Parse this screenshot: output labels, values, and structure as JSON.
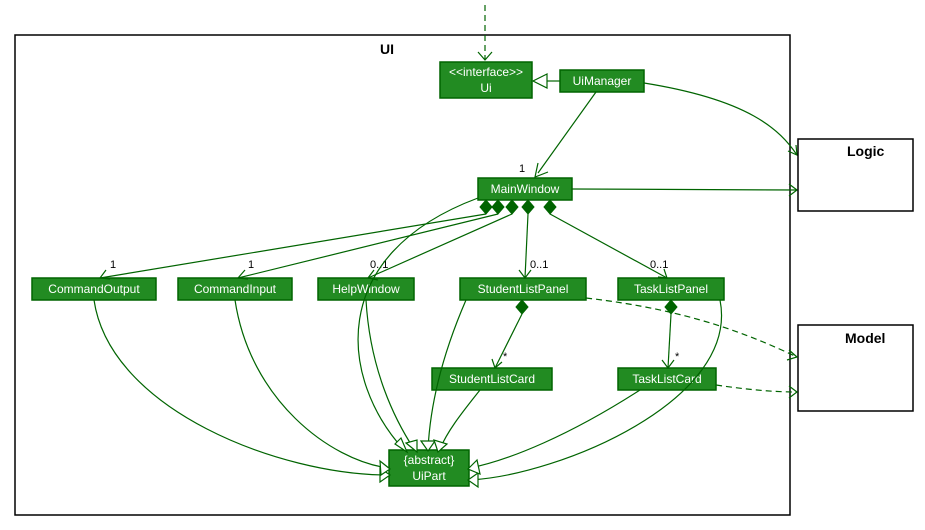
{
  "package": {
    "name": "UI"
  },
  "classes": {
    "ui": {
      "stereotype": "<<interface>>",
      "name": "Ui"
    },
    "uimanager": {
      "name": "UiManager"
    },
    "mainwindow": {
      "name": "MainWindow"
    },
    "cmdout": {
      "name": "CommandOutput"
    },
    "cmdin": {
      "name": "CommandInput"
    },
    "helpwin": {
      "name": "HelpWindow"
    },
    "slpanel": {
      "name": "StudentListPanel"
    },
    "tlpanel": {
      "name": "TaskListPanel"
    },
    "slc": {
      "name": "StudentListCard"
    },
    "tlc": {
      "name": "TaskListCard"
    },
    "uipart": {
      "stereotype": "{abstract}",
      "name": "UiPart"
    }
  },
  "external": {
    "logic": {
      "name": "Logic"
    },
    "model": {
      "name": "Model"
    }
  },
  "mult": {
    "mw_from_uimgr": "1",
    "cmdout": "1",
    "cmdin": "1",
    "helpwin": "0..1",
    "slpanel": "0..1",
    "tlpanel": "0..1",
    "slc": "*",
    "tlc": "*"
  }
}
